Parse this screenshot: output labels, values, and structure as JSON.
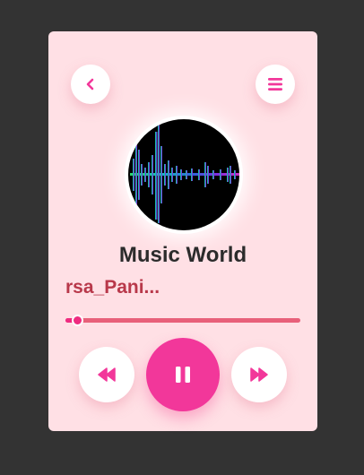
{
  "colors": {
    "background": "#333333",
    "card": "#ffe0e5",
    "accent": "#f2379a",
    "artist_text": "#b8384a",
    "progress_track": "#e8607a"
  },
  "header": {
    "back_icon": "chevron-left-icon",
    "menu_icon": "hamburger-menu-icon"
  },
  "now_playing": {
    "title": "Music World",
    "artist": "rsa_Pani...",
    "artwork": "audio-waveform-artwork"
  },
  "progress": {
    "fraction": 0.05
  },
  "controls": {
    "prev_icon": "rewind-icon",
    "play_pause_icon": "pause-icon",
    "next_icon": "fast-forward-icon"
  }
}
